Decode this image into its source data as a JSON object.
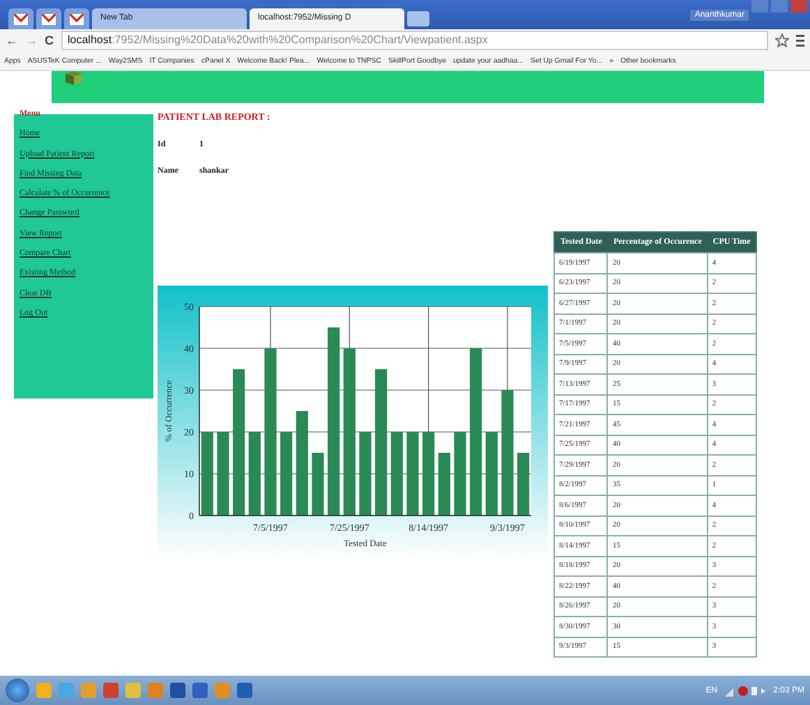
{
  "browser": {
    "tabs": [
      {
        "kind": "icon",
        "selected": false
      },
      {
        "kind": "icon",
        "selected": false
      },
      {
        "kind": "icon",
        "selected": false
      },
      {
        "kind": "tab",
        "label": "New Tab",
        "selected": false
      },
      {
        "kind": "tab",
        "label": "localhost:7952/Missing D",
        "selected": true
      }
    ],
    "user": "Ananthkumar",
    "nav": [
      "←",
      "→",
      "C"
    ],
    "address_host": "localhost",
    "address_path": ":7952/Missing%20Data%20with%20Comparison%20Chart/Viewpatient.aspx",
    "bookmarks": [
      "Apps",
      "ASUSTeK Computer ...",
      "Way2SMS",
      "IT Companies",
      "cPanel X",
      "Welcome Back! Plea...",
      "Welcome to TNPSC",
      "SkillPort Goodbye",
      "update your aadhaa...",
      "Set Up Gmail For Yo...",
      "»",
      "Other bookmarks"
    ]
  },
  "menu": {
    "title": "Menu",
    "items": [
      "Home",
      "Upload Patient Report",
      "Find Missing Data",
      "Calculate % of Occurrence",
      "Change Password",
      "View Report",
      "Compare Chart",
      "Existing Method",
      "Clear DB",
      "Log Out"
    ]
  },
  "report": {
    "title": "PATIENT LAB REPORT :",
    "fields": [
      {
        "label": "Id",
        "value": "1"
      },
      {
        "label": "Name",
        "value": "shankar"
      }
    ]
  },
  "chart": {
    "chart_data": {
      "type": "bar",
      "xlabel": "Tested Date",
      "ylabel": "% of Occurrence",
      "categories": [
        null,
        null,
        null,
        null,
        "7/5/1997",
        null,
        null,
        null,
        null,
        "7/25/1997",
        null,
        null,
        null,
        null,
        "8/14/1997",
        null,
        null,
        null,
        null,
        "9/3/1997",
        null
      ],
      "grid": true,
      "values": [
        20,
        20,
        35,
        20,
        40,
        20,
        25,
        15,
        45,
        40,
        20,
        35,
        20,
        20,
        20,
        15,
        20,
        40,
        20,
        30,
        15
      ],
      "ylim": [
        0,
        50
      ],
      "yticks": [
        0,
        10,
        20,
        30,
        40,
        50
      ]
    }
  },
  "table": {
    "columns": [
      "Tested Date",
      "Percentage of Occurence",
      "CPU Time"
    ],
    "rows": [
      [
        "6/19/1997",
        "20",
        "4"
      ],
      [
        "6/23/1997",
        "20",
        "2"
      ],
      [
        "6/27/1997",
        "20",
        "2"
      ],
      [
        "7/1/1997",
        "20",
        "2"
      ],
      [
        "7/5/1997",
        "40",
        "2"
      ],
      [
        "7/9/1997",
        "20",
        "4"
      ],
      [
        "7/13/1997",
        "25",
        "3"
      ],
      [
        "7/17/1997",
        "15",
        "2"
      ],
      [
        "7/21/1997",
        "45",
        "4"
      ],
      [
        "7/25/1997",
        "40",
        "4"
      ],
      [
        "7/29/1997",
        "20",
        "2"
      ],
      [
        "8/2/1997",
        "35",
        "1"
      ],
      [
        "8/6/1997",
        "20",
        "4"
      ],
      [
        "8/10/1997",
        "20",
        "2"
      ],
      [
        "8/14/1997",
        "15",
        "2"
      ],
      [
        "8/18/1997",
        "20",
        "3"
      ],
      [
        "8/22/1997",
        "40",
        "2"
      ],
      [
        "8/26/1997",
        "20",
        "3"
      ],
      [
        "8/30/1997",
        "30",
        "3"
      ],
      [
        "9/3/1997",
        "15",
        "3"
      ]
    ]
  },
  "taskbar": {
    "icons": [
      {
        "color": "#f0b020"
      },
      {
        "color": "#4aa8e0"
      },
      {
        "color": "#e0a030"
      },
      {
        "color": "#d04030"
      },
      {
        "color": "#e0c040"
      },
      {
        "color": "#e08020"
      },
      {
        "color": "#2050a0"
      },
      {
        "color": "#3060c0"
      },
      {
        "color": "#e09020"
      },
      {
        "color": "#2060b0"
      }
    ],
    "language": "EN",
    "time": "2:03 PM"
  }
}
